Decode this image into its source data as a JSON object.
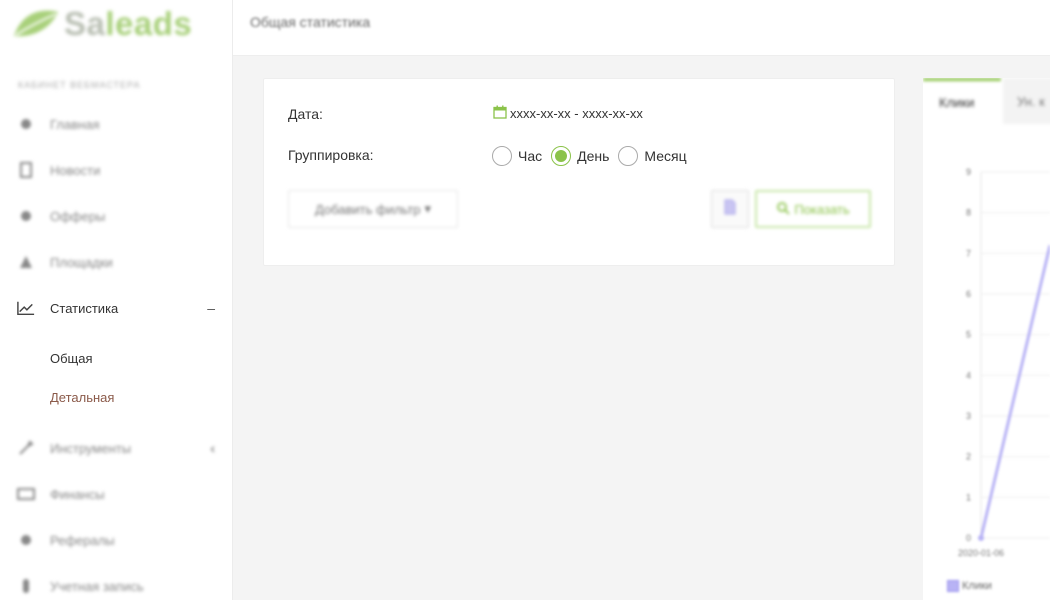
{
  "logo": {
    "prefix": "Sa",
    "suffix": "leads"
  },
  "sidebar": {
    "section_title": "КАБИНЕТ ВЕБМАСТЕРА",
    "items": [
      {
        "label": "Главная",
        "icon": "home-icon"
      },
      {
        "label": "Новости",
        "icon": "news-icon"
      },
      {
        "label": "Офферы",
        "icon": "offers-icon"
      },
      {
        "label": "Площадки",
        "icon": "platforms-icon"
      },
      {
        "label": "Статистика",
        "icon": "chart-line-icon",
        "control": "–"
      },
      {
        "label": "Инструменты",
        "icon": "tools-icon",
        "control": "‹"
      },
      {
        "label": "Финансы",
        "icon": "finance-icon"
      },
      {
        "label": "Рефералы",
        "icon": "referrals-icon"
      },
      {
        "label": "Учетная запись",
        "icon": "account-icon"
      }
    ],
    "subitems": [
      {
        "label": "Общая"
      },
      {
        "label": "Детальная"
      }
    ]
  },
  "header": {
    "title": "Общая статистика"
  },
  "filter": {
    "date_label": "Дата:",
    "date_value": "xxxx-xx-xx - xxxx-xx-xx",
    "grouping_label": "Группировка:",
    "grouping_options": [
      {
        "label": "Час",
        "checked": false
      },
      {
        "label": "День",
        "checked": true
      },
      {
        "label": "Месяц",
        "checked": false
      }
    ],
    "add_filter_label": "Добавить фильтр",
    "show_label": "Показать"
  },
  "chart_panel": {
    "tabs": [
      {
        "label": "Клики",
        "active": true
      },
      {
        "label": "Ун. к",
        "active": false
      }
    ],
    "legend_label": "Клики",
    "series_color": "#b8b3f5"
  },
  "chart_data": {
    "type": "line",
    "x": [
      "2020-01-06",
      "..."
    ],
    "y_ticks": [
      0,
      1,
      2,
      3,
      4,
      5,
      6,
      7,
      8,
      9
    ],
    "series": [
      {
        "name": "Клики",
        "values": [
          0,
          7.2
        ]
      }
    ],
    "ylim": [
      0,
      9
    ],
    "x_tick_labels": [
      "2020-01-06"
    ],
    "grid": true,
    "legend": "bottom-left"
  },
  "colors": {
    "accent": "#8bc34a",
    "series": "#b8b3f5"
  }
}
